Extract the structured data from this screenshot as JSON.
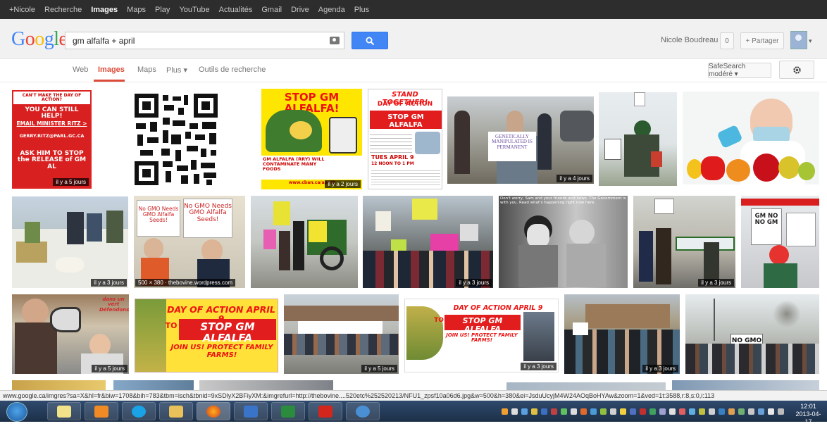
{
  "gbar": {
    "items": [
      "+Nicole",
      "Recherche",
      "Images",
      "Maps",
      "Play",
      "YouTube",
      "Actualités",
      "Gmail",
      "Drive",
      "Agenda",
      "Plus"
    ],
    "active_index": 2
  },
  "header": {
    "logo": "Google",
    "search_value": "gm alfalfa + april",
    "user_name": "Nicole Boudreau",
    "notifications": "0",
    "share_label": "+ Partager"
  },
  "nav": {
    "tabs": [
      "Web",
      "Images",
      "Maps",
      "Plus ▾",
      "Outils de recherche"
    ],
    "active_tab": "Images",
    "safesearch": "SafeSearch modéré ▾"
  },
  "results": {
    "age_labels": {
      "y4": "il y a 4 jours",
      "y5": "il y a 5 jours",
      "y2": "il y a 2 jours",
      "y3": "il y a 3 jours"
    },
    "thumb1": {
      "line1": "CAN'T MAKE THE DAY OF ACTION?",
      "line2": "YOU CAN STILL HELP!",
      "line3": "EMAIL MINISTER RITZ >",
      "line4": "GERRY.RITZ@PARL.GC.CA",
      "line5": "ASK HIM TO STOP the RELEASE of GM AL"
    },
    "thumb3": {
      "title": "STOP GM ALFALFA!",
      "caption": "GM ALFALFA (RRY) WILL CONTAMINATE MANY FOODS",
      "url": "www.cban.ca/april9"
    },
    "thumb4": {
      "title1": "STAND TOGETHER!",
      "title2": "DAY OF ACTION",
      "title3": "STOP GM ALFALFA",
      "date": "TUES APRIL 9",
      "time": "12 NOON TO 1 PM"
    },
    "thumb5_sign": "GENETICALLY MANIPULATED IS PERMANENT",
    "thumb9_signs": [
      "No GMO Needs GMO Alfalfa Seeds!",
      "No GMO Needs GMO Alfalfa Seeds!"
    ],
    "thumb9_info": "500 × 380 · thebovine.wordpress.com",
    "thumb12_caption": "Don't worry, Sam and your friends and news. The Government is with you. Read what's happening right now here.",
    "thumb14_sign": "GM NO NO GM",
    "banner": {
      "line1": "DAY OF ACTION APRIL 9",
      "prefix": "TO",
      "line2": "STOP GM ALFALFA",
      "line3": "JOIN US! PROTECT FAMILY FARMS!"
    },
    "thumb15_sign": "dans un vert Défendons",
    "thumb20_sign": "NO GMO"
  },
  "statusbar": {
    "url": "www.google.ca/imgres?sa=X&hl=fr&biw=1708&bih=783&tbm=isch&tbnid=9xSDlyX2BFiyXM:&imgrefurl=http://thebovine....520etc%252520213/NFU1_zpsf10a06d6.jpg&w=500&h=380&ei=JsduUcyjM4W24AOqBoHYAw&zoom=1&ved=1t:3588,r:8,s:0,i:113"
  },
  "taskbar": {
    "time": "12:01",
    "date": "2013-04-17"
  },
  "colors": {
    "accent_red": "#dd4b39",
    "search_blue": "#4285f4",
    "bar_dark": "#2d2d2d"
  }
}
